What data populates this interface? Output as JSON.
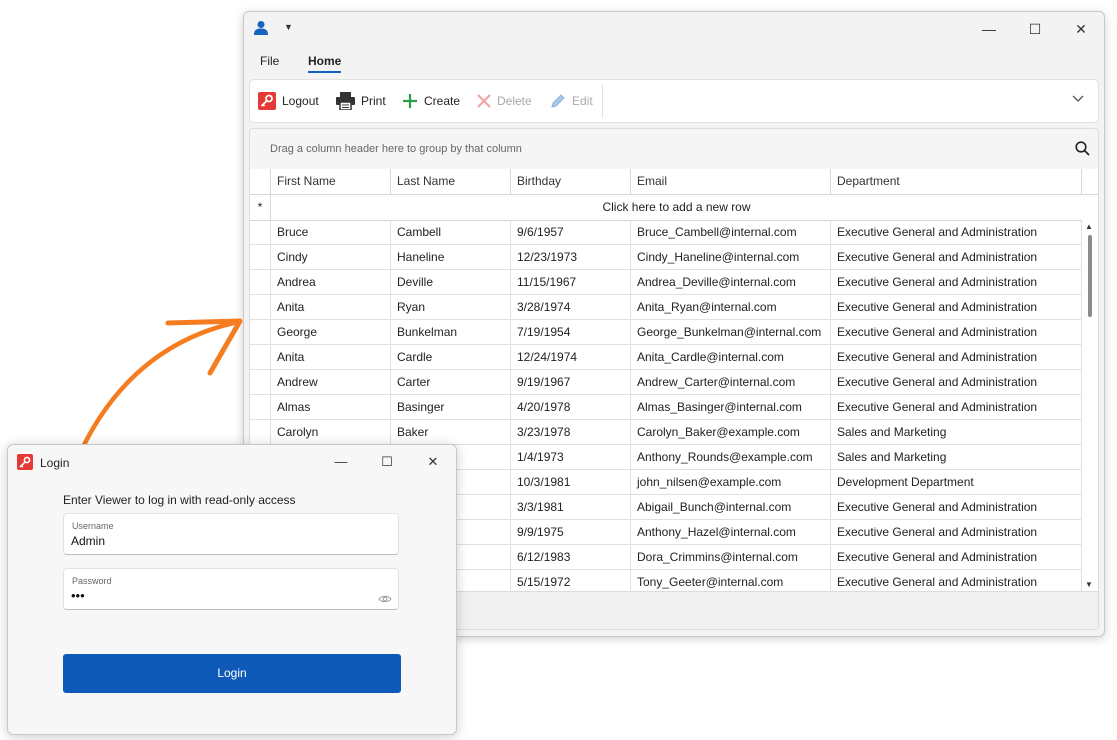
{
  "main_window": {
    "tabs": [
      {
        "label": "File"
      },
      {
        "label": "Home"
      }
    ],
    "ribbon": {
      "logout": "Logout",
      "print": "Print",
      "create": "Create",
      "delete": "Delete",
      "edit": "Edit"
    },
    "grid": {
      "group_hint": "Drag a column header here to group by that column",
      "columns": [
        "First Name",
        "Last Name",
        "Birthday",
        "Email",
        "Department"
      ],
      "new_row_indicator": "*",
      "new_row_text": "Click here to add a new row",
      "rows": [
        [
          "Bruce",
          "Cambell",
          "9/6/1957",
          "Bruce_Cambell@internal.com",
          "Executive General and Administration"
        ],
        [
          "Cindy",
          "Haneline",
          "12/23/1973",
          "Cindy_Haneline@internal.com",
          "Executive General and Administration"
        ],
        [
          "Andrea",
          "Deville",
          "11/15/1967",
          "Andrea_Deville@internal.com",
          "Executive General and Administration"
        ],
        [
          "Anita",
          "Ryan",
          "3/28/1974",
          "Anita_Ryan@internal.com",
          "Executive General and Administration"
        ],
        [
          "George",
          "Bunkelman",
          "7/19/1954",
          "George_Bunkelman@internal.com",
          "Executive General and Administration"
        ],
        [
          "Anita",
          "Cardle",
          "12/24/1974",
          "Anita_Cardle@internal.com",
          "Executive General and Administration"
        ],
        [
          "Andrew",
          "Carter",
          "9/19/1967",
          "Andrew_Carter@internal.com",
          "Executive General and Administration"
        ],
        [
          "Almas",
          "Basinger",
          "4/20/1978",
          "Almas_Basinger@internal.com",
          "Executive General and Administration"
        ],
        [
          "Carolyn",
          "Baker",
          "3/23/1978",
          "Carolyn_Baker@example.com",
          "Sales and Marketing"
        ],
        [
          "",
          "",
          "1/4/1973",
          "Anthony_Rounds@example.com",
          "Sales and Marketing"
        ],
        [
          "",
          "",
          "10/3/1981",
          "john_nilsen@example.com",
          "Development Department"
        ],
        [
          "",
          "",
          "3/3/1981",
          "Abigail_Bunch@internal.com",
          "Executive General and Administration"
        ],
        [
          "",
          "",
          "9/9/1975",
          "Anthony_Hazel@internal.com",
          "Executive General and Administration"
        ],
        [
          "",
          "",
          "6/12/1983",
          "Dora_Crimmins@internal.com",
          "Executive General and Administration"
        ],
        [
          "",
          "",
          "5/15/1972",
          "Tony_Geeter@internal.com",
          "Executive General and Administration"
        ]
      ]
    }
  },
  "login_dialog": {
    "title": "Login",
    "hint": "Enter Viewer to log in with read-only access",
    "username_label": "Username",
    "username_value": "Admin",
    "password_label": "Password",
    "password_value": "•••",
    "login_button": "Login"
  },
  "colors": {
    "accent": "#1560bd",
    "login_button": "#0f5ab8",
    "arrow": "#f57c1f",
    "logout_icon": "#e53935",
    "create_icon": "#2e9e44",
    "delete_icon": "#f3a0a0"
  }
}
